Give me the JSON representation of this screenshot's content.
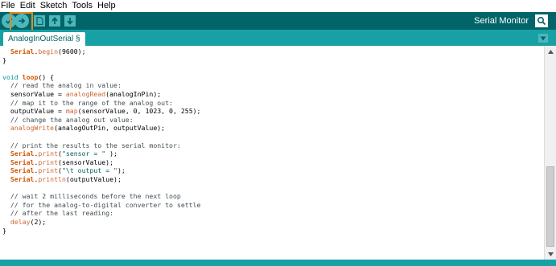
{
  "menu": [
    "File",
    "Edit",
    "Sketch",
    "Tools",
    "Help"
  ],
  "toolbar": {
    "buttons": [
      "verify-icon",
      "upload-icon",
      "new-icon",
      "open-icon",
      "save-icon"
    ],
    "serial_label": "Serial Monitor",
    "serial_icon": "magnifier-icon"
  },
  "tab": {
    "label": "AnalogInOutSerial §"
  },
  "colors": {
    "toolbar_bg": "#006468",
    "tabbar_bg": "#17a1a5",
    "highlight_border": "#e38b1c",
    "keyword": "#d35400",
    "function": "#cc6633",
    "comment": "#434f54",
    "string": "#005c5f"
  },
  "code": [
    [
      {
        "c": "pl",
        "t": "  "
      },
      {
        "c": "kw",
        "t": "Serial"
      },
      {
        "c": "pl",
        "t": "."
      },
      {
        "c": "fn",
        "t": "begin"
      },
      {
        "c": "pl",
        "t": "(9600);"
      }
    ],
    [
      {
        "c": "pl",
        "t": "}"
      }
    ],
    [
      {
        "c": "pl",
        "t": ""
      }
    ],
    [
      {
        "c": "ty",
        "t": "void"
      },
      {
        "c": "pl",
        "t": " "
      },
      {
        "c": "kw",
        "t": "loop"
      },
      {
        "c": "pl",
        "t": "() {"
      }
    ],
    [
      {
        "c": "cm",
        "t": "  // read the analog in value:"
      }
    ],
    [
      {
        "c": "pl",
        "t": "  sensorValue = "
      },
      {
        "c": "fn",
        "t": "analogRead"
      },
      {
        "c": "pl",
        "t": "(analogInPin);"
      }
    ],
    [
      {
        "c": "cm",
        "t": "  // map it to the range of the analog out:"
      }
    ],
    [
      {
        "c": "pl",
        "t": "  outputValue = "
      },
      {
        "c": "fn",
        "t": "map"
      },
      {
        "c": "pl",
        "t": "(sensorValue, 0, 1023, 0, 255);"
      }
    ],
    [
      {
        "c": "cm",
        "t": "  // change the analog out value:"
      }
    ],
    [
      {
        "c": "pl",
        "t": "  "
      },
      {
        "c": "fn",
        "t": "analogWrite"
      },
      {
        "c": "pl",
        "t": "(analogOutPin, outputValue);"
      }
    ],
    [
      {
        "c": "pl",
        "t": ""
      }
    ],
    [
      {
        "c": "cm",
        "t": "  // print the results to the serial monitor:"
      }
    ],
    [
      {
        "c": "pl",
        "t": "  "
      },
      {
        "c": "kw",
        "t": "Serial"
      },
      {
        "c": "pl",
        "t": "."
      },
      {
        "c": "fn",
        "t": "print"
      },
      {
        "c": "pl",
        "t": "("
      },
      {
        "c": "str",
        "t": "\"sensor = \""
      },
      {
        "c": "pl",
        "t": " );"
      }
    ],
    [
      {
        "c": "pl",
        "t": "  "
      },
      {
        "c": "kw",
        "t": "Serial"
      },
      {
        "c": "pl",
        "t": "."
      },
      {
        "c": "fn",
        "t": "print"
      },
      {
        "c": "pl",
        "t": "(sensorValue);"
      }
    ],
    [
      {
        "c": "pl",
        "t": "  "
      },
      {
        "c": "kw",
        "t": "Serial"
      },
      {
        "c": "pl",
        "t": "."
      },
      {
        "c": "fn",
        "t": "print"
      },
      {
        "c": "pl",
        "t": "("
      },
      {
        "c": "str",
        "t": "\"\\t output = \""
      },
      {
        "c": "pl",
        "t": ");"
      }
    ],
    [
      {
        "c": "pl",
        "t": "  "
      },
      {
        "c": "kw",
        "t": "Serial"
      },
      {
        "c": "pl",
        "t": "."
      },
      {
        "c": "fn",
        "t": "println"
      },
      {
        "c": "pl",
        "t": "(outputValue);"
      }
    ],
    [
      {
        "c": "pl",
        "t": ""
      }
    ],
    [
      {
        "c": "cm",
        "t": "  // wait 2 milliseconds before the next loop"
      }
    ],
    [
      {
        "c": "cm",
        "t": "  // for the analog-to-digital converter to settle"
      }
    ],
    [
      {
        "c": "cm",
        "t": "  // after the last reading:"
      }
    ],
    [
      {
        "c": "pl",
        "t": "  "
      },
      {
        "c": "fn",
        "t": "delay"
      },
      {
        "c": "pl",
        "t": "(2);"
      }
    ],
    [
      {
        "c": "pl",
        "t": "}"
      }
    ]
  ]
}
